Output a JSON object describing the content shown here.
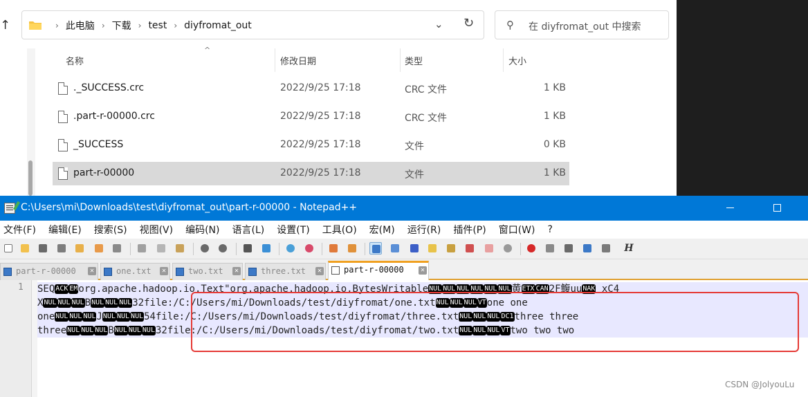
{
  "explorer": {
    "breadcrumbs": [
      "此电脑",
      "下载",
      "test",
      "diyfromat_out"
    ],
    "search_placeholder": "在 diyfromat_out 中搜索",
    "columns": [
      "名称",
      "修改日期",
      "类型",
      "大小"
    ],
    "files": [
      {
        "name": "._SUCCESS.crc",
        "modified": "2022/9/25 17:18",
        "type": "CRC 文件",
        "size": "1 KB",
        "selected": false
      },
      {
        "name": ".part-r-00000.crc",
        "modified": "2022/9/25 17:18",
        "type": "CRC 文件",
        "size": "1 KB",
        "selected": false
      },
      {
        "name": "_SUCCESS",
        "modified": "2022/9/25 17:18",
        "type": "文件",
        "size": "0 KB",
        "selected": false
      },
      {
        "name": "part-r-00000",
        "modified": "2022/9/25 17:18",
        "type": "文件",
        "size": "1 KB",
        "selected": true
      }
    ]
  },
  "notepad": {
    "title": "C:\\Users\\mi\\Downloads\\test\\diyfromat_out\\part-r-00000 - Notepad++",
    "menu": [
      "文件(F)",
      "编辑(E)",
      "搜索(S)",
      "视图(V)",
      "编码(N)",
      "语言(L)",
      "设置(T)",
      "工具(O)",
      "宏(M)",
      "运行(R)",
      "插件(P)",
      "窗口(W)",
      "?"
    ],
    "tabs": [
      {
        "label": "part-r-00000",
        "active": false
      },
      {
        "label": "one.txt",
        "active": false
      },
      {
        "label": "two.txt",
        "active": false
      },
      {
        "label": "three.txt",
        "active": false
      },
      {
        "label": "part-r-00000",
        "active": true
      }
    ],
    "line_number": "1",
    "code_lines": [
      [
        [
          "t",
          "SEQ"
        ],
        [
          "c",
          "ACK"
        ],
        [
          "c",
          "EM"
        ],
        [
          "t",
          "org.apache.hadoop.io.Text\"org.apache.hadoop.io.BytesWritable"
        ],
        [
          "c",
          "NUL"
        ],
        [
          "c",
          "NUL"
        ],
        [
          "c",
          "NUL"
        ],
        [
          "c",
          "NUL"
        ],
        [
          "c",
          "NUL"
        ],
        [
          "c",
          "NUL"
        ],
        [
          "t",
          "黄"
        ],
        [
          "c",
          "ETX"
        ],
        [
          "c",
          "CAN"
        ],
        [
          "t",
          "2F鳆uu"
        ],
        [
          "c",
          "NAK"
        ],
        [
          "t",
          " xC4"
        ]
      ],
      [
        [
          "t",
          "X"
        ],
        [
          "c",
          "NUL"
        ],
        [
          "c",
          "NUL"
        ],
        [
          "c",
          "NUL"
        ],
        [
          "t",
          "B"
        ],
        [
          "c",
          "NUL"
        ],
        [
          "c",
          "NUL"
        ],
        [
          "c",
          "NUL"
        ],
        [
          "t",
          "32file:/C:/Users/mi/Downloads/test/diyfromat/one.txt"
        ],
        [
          "c",
          "NUL"
        ],
        [
          "c",
          "NUL"
        ],
        [
          "c",
          "NUL"
        ],
        [
          "c",
          "VT"
        ],
        [
          "t",
          "one one"
        ]
      ],
      [
        [
          "t",
          "one"
        ],
        [
          "c",
          "NUL"
        ],
        [
          "c",
          "NUL"
        ],
        [
          "c",
          "NUL"
        ],
        [
          "t",
          "J"
        ],
        [
          "c",
          "NUL"
        ],
        [
          "c",
          "NUL"
        ],
        [
          "c",
          "NUL"
        ],
        [
          "t",
          "54file:/C:/Users/mi/Downloads/test/diyfromat/three.txt"
        ],
        [
          "c",
          "NUL"
        ],
        [
          "c",
          "NUL"
        ],
        [
          "c",
          "NUL"
        ],
        [
          "c",
          "DC1"
        ],
        [
          "t",
          "three three"
        ]
      ],
      [
        [
          "t",
          "three"
        ],
        [
          "c",
          "NUL"
        ],
        [
          "c",
          "NUL"
        ],
        [
          "c",
          "NUL"
        ],
        [
          "t",
          "B"
        ],
        [
          "c",
          "NUL"
        ],
        [
          "c",
          "NUL"
        ],
        [
          "c",
          "NUL"
        ],
        [
          "t",
          "32file:/C:/Users/mi/Downloads/test/diyfromat/two.txt"
        ],
        [
          "c",
          "NUL"
        ],
        [
          "c",
          "NUL"
        ],
        [
          "c",
          "NUL"
        ],
        [
          "c",
          "VT"
        ],
        [
          "t",
          "two two two"
        ]
      ]
    ]
  },
  "watermark": "CSDN @JolyouLu",
  "colors": {
    "titlebar": "#0078d7",
    "highlight": "#e8e8ff",
    "annotation": "#e53935",
    "tab_accent": "#f0a020"
  }
}
